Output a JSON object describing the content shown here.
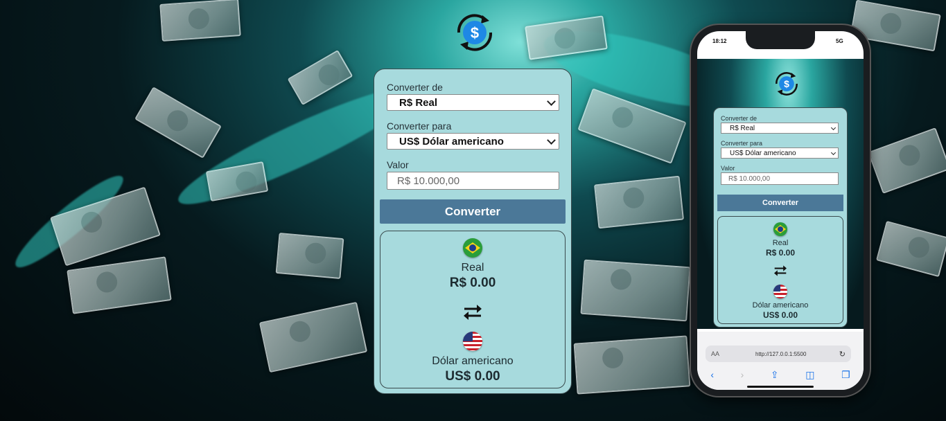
{
  "converter": {
    "from_label": "Converter de",
    "from_value": "R$ Real",
    "to_label": "Converter para",
    "to_value": "US$ Dólar americano",
    "amount_label": "Valor",
    "amount_placeholder": "R$ 10.000,00",
    "convert_button": "Converter",
    "result_from_name": "Real",
    "result_from_value": "R$ 0.00",
    "result_to_name": "Dólar americano",
    "result_to_value": "US$ 0.00"
  },
  "phone": {
    "time": "18:12",
    "network": "5G",
    "url": "http://127.0.0.1:5500",
    "aa": "AA"
  },
  "colors": {
    "card_bg": "#a7dadd",
    "button": "#4b7898",
    "logo_blue": "#1e88e5"
  },
  "icons": [
    "dollar-exchange-logo-icon",
    "swap-arrows-icon",
    "brazil-flag-icon",
    "usa-flag-icon"
  ]
}
